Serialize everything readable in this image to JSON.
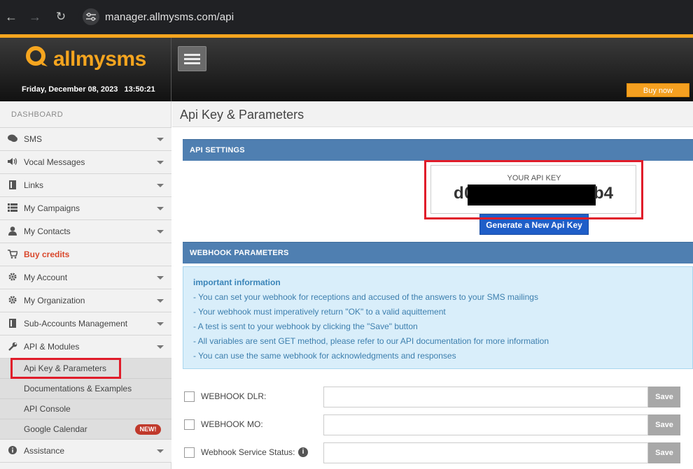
{
  "browser": {
    "url": "manager.allmysms.com/api",
    "back_icon": "←",
    "forward_icon": "→",
    "reload_icon": "↻"
  },
  "header": {
    "logo_text": "allmysms",
    "date_time": "Friday, December 08, 2023   13:50:21",
    "buy_now": "Buy now",
    "accent_color": "#f5a51f"
  },
  "sidebar": {
    "dashboard": "DASHBOARD",
    "items": [
      {
        "label": "SMS",
        "icon": "chat-icon"
      },
      {
        "label": "Vocal Messages",
        "icon": "speaker-icon"
      },
      {
        "label": "Links",
        "icon": "document-icon"
      },
      {
        "label": "My Campaigns",
        "icon": "list-icon"
      },
      {
        "label": "My Contacts",
        "icon": "user-icon"
      },
      {
        "label": "Buy credits",
        "icon": "cart-icon"
      },
      {
        "label": "My Account",
        "icon": "gear-icon"
      },
      {
        "label": "My Organization",
        "icon": "gear-icon"
      },
      {
        "label": "Sub-Accounts Management",
        "icon": "document-icon"
      },
      {
        "label": "API & Modules",
        "icon": "wrench-icon"
      }
    ],
    "sub_items": [
      {
        "label": "Api Key & Parameters"
      },
      {
        "label": "Documentations & Examples"
      },
      {
        "label": "API Console"
      },
      {
        "label": "Google Calendar",
        "badge": "NEW!"
      }
    ],
    "assistance": {
      "label": "Assistance",
      "icon": "info-icon"
    }
  },
  "main": {
    "page_title": "Api Key & Parameters",
    "api_settings": {
      "heading": "API SETTINGS",
      "key_label": "YOUR API KEY",
      "key_prefix": "d0",
      "key_suffix": "b4",
      "generate_button": "Generate a New Api Key"
    },
    "webhook": {
      "heading": "WEBHOOK PARAMETERS",
      "info_title": "important information",
      "info_lines": [
        "- You can set your webhook for receptions and accused of the answers to your SMS mailings",
        "- Your webhook must imperatively return \"OK\" to a valid aquittement",
        "- A test is sent to your webhook by clicking the \"Save\" button",
        "- All variables are sent GET method, please refer to our API documentation for more information",
        "- You can use the same webhook for acknowledgments and responses"
      ],
      "rows": [
        {
          "label": "WEBHOOK DLR:",
          "value": "",
          "save": "Save"
        },
        {
          "label": "WEBHOOK MO:",
          "value": "",
          "save": "Save"
        },
        {
          "label": "Webhook Service Status:",
          "value": "",
          "save": "Save",
          "info_icon": "i"
        }
      ]
    }
  }
}
